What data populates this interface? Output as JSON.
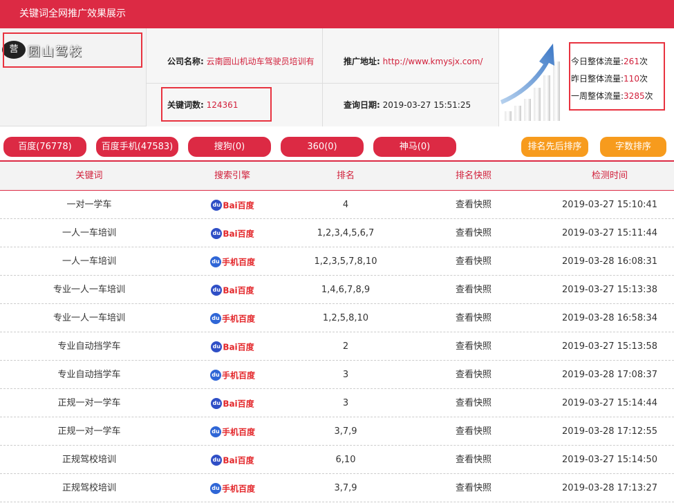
{
  "header": {
    "title": "关键词全网推广效果展示"
  },
  "logo": {
    "badge_text": "营",
    "text": "圆山驾校"
  },
  "info": {
    "company_label": "公司名称:",
    "company_value": "云南圆山机动车驾驶员培训有",
    "keywords_label": "关键词数:",
    "keywords_value": "124361",
    "address_label": "推广地址:",
    "address_value": "http://www.kmysjx.com/",
    "date_label": "查询日期:",
    "date_value": "2019-03-27 15:51:25"
  },
  "stats": {
    "today_label": "今日整体流量:",
    "today_value": "261",
    "yesterday_label": "昨日整体流量:",
    "yesterday_value": "110",
    "week_label": "一周整体流量:",
    "week_value": "3285",
    "unit": "次"
  },
  "tabs": [
    {
      "label": "百度(76778)"
    },
    {
      "label": "百度手机(47583)"
    },
    {
      "label": "搜狗(0)"
    },
    {
      "label": "360(0)"
    },
    {
      "label": "神马(0)"
    }
  ],
  "sort_buttons": {
    "rank_sort": "排名先后排序",
    "char_sort": "字数排序"
  },
  "table": {
    "headers": [
      "关键词",
      "搜索引擎",
      "排名",
      "排名快照",
      "检测时间"
    ],
    "engine_labels": {
      "baidu": "Bai百度",
      "baidu_mobile": "手机百度"
    },
    "rows": [
      {
        "keyword": "一对一学车",
        "engine": "baidu",
        "rank": "4",
        "snapshot": "查看快照",
        "time": "2019-03-27 15:10:41"
      },
      {
        "keyword": "一人一车培训",
        "engine": "baidu",
        "rank": "1,2,3,4,5,6,7",
        "snapshot": "查看快照",
        "time": "2019-03-27 15:11:44"
      },
      {
        "keyword": "一人一车培训",
        "engine": "baidu_mobile",
        "rank": "1,2,3,5,7,8,10",
        "snapshot": "查看快照",
        "time": "2019-03-28 16:08:31"
      },
      {
        "keyword": "专业一人一车培训",
        "engine": "baidu",
        "rank": "1,4,6,7,8,9",
        "snapshot": "查看快照",
        "time": "2019-03-27 15:13:38"
      },
      {
        "keyword": "专业一人一车培训",
        "engine": "baidu_mobile",
        "rank": "1,2,5,8,10",
        "snapshot": "查看快照",
        "time": "2019-03-28 16:58:34"
      },
      {
        "keyword": "专业自动挡学车",
        "engine": "baidu",
        "rank": "2",
        "snapshot": "查看快照",
        "time": "2019-03-27 15:13:58"
      },
      {
        "keyword": "专业自动挡学车",
        "engine": "baidu_mobile",
        "rank": "3",
        "snapshot": "查看快照",
        "time": "2019-03-28 17:08:37"
      },
      {
        "keyword": "正规一对一学车",
        "engine": "baidu",
        "rank": "3",
        "snapshot": "查看快照",
        "time": "2019-03-27 15:14:44"
      },
      {
        "keyword": "正规一对一学车",
        "engine": "baidu_mobile",
        "rank": "3,7,9",
        "snapshot": "查看快照",
        "time": "2019-03-28 17:12:55"
      },
      {
        "keyword": "正规驾校培训",
        "engine": "baidu",
        "rank": "6,10",
        "snapshot": "查看快照",
        "time": "2019-03-27 15:14:50"
      },
      {
        "keyword": "正规驾校培训",
        "engine": "baidu_mobile",
        "rank": "3,7,9",
        "snapshot": "查看快照",
        "time": "2019-03-28 17:13:27"
      }
    ]
  },
  "colors": {
    "brand_red": "#dc2a44",
    "sort_orange": "#f79b1d",
    "highlight_box": "#e8323f"
  }
}
